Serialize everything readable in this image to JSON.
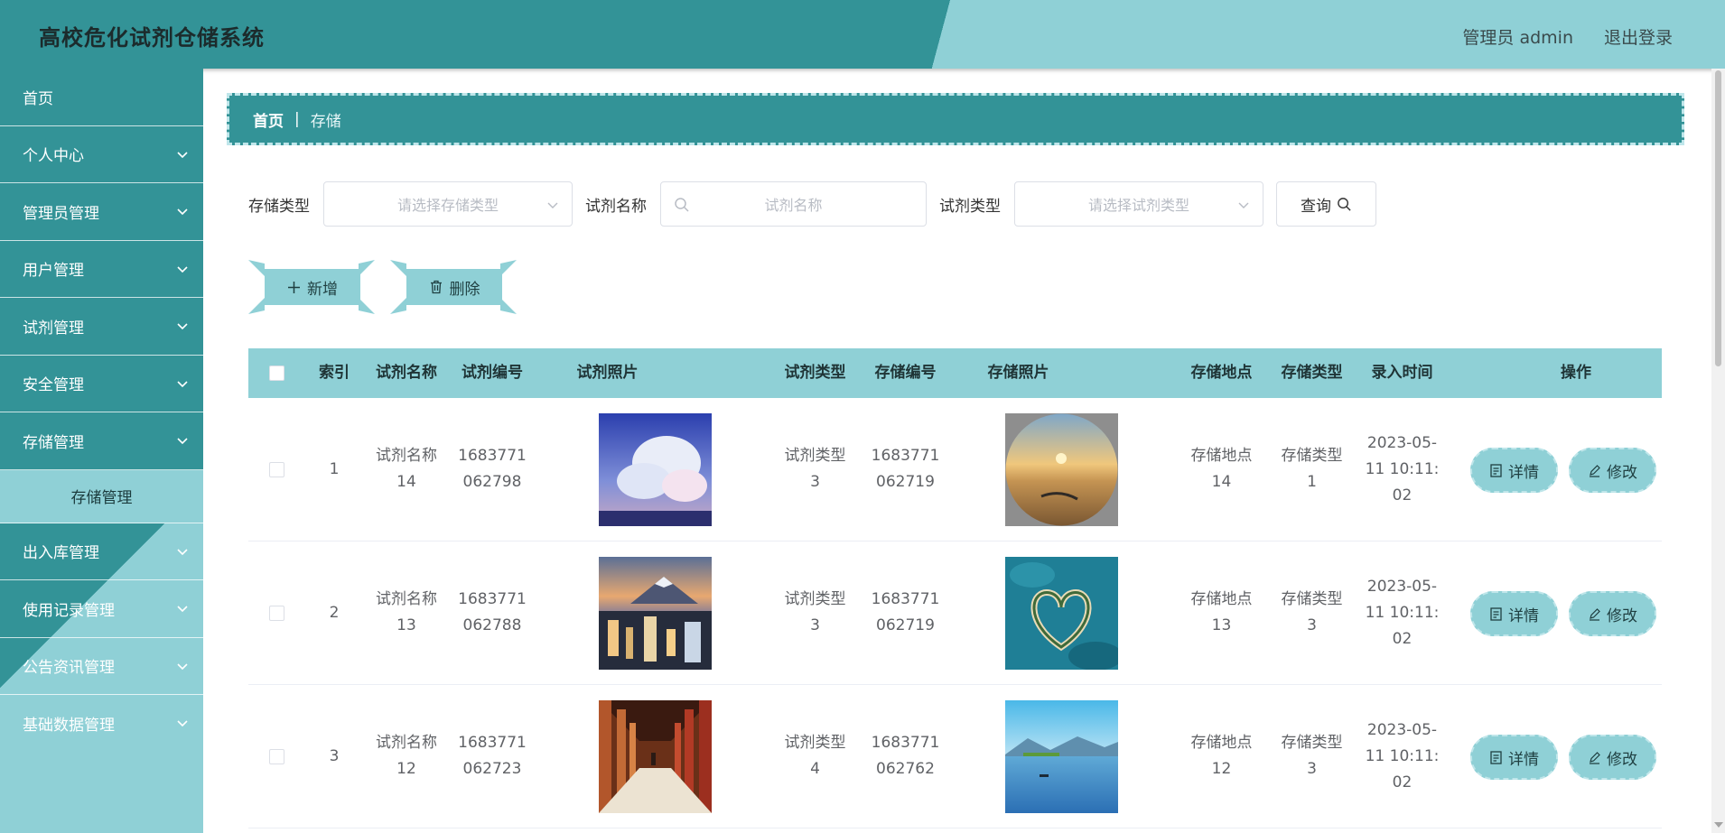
{
  "app": {
    "title": "高校危化试剂仓储系统",
    "user": "管理员 admin",
    "logout": "退出登录"
  },
  "sidebar": {
    "items": [
      {
        "label": "首页",
        "expandable": false
      },
      {
        "label": "个人中心",
        "expandable": true
      },
      {
        "label": "管理员管理",
        "expandable": true
      },
      {
        "label": "用户管理",
        "expandable": true
      },
      {
        "label": "试剂管理",
        "expandable": true
      },
      {
        "label": "安全管理",
        "expandable": true
      },
      {
        "label": "存储管理",
        "expandable": true,
        "open": true
      },
      {
        "label": "出入库管理",
        "expandable": true
      },
      {
        "label": "使用记录管理",
        "expandable": true
      },
      {
        "label": "公告资讯管理",
        "expandable": true
      },
      {
        "label": "基础数据管理",
        "expandable": true
      }
    ],
    "submenu": {
      "label": "存储管理"
    }
  },
  "breadcrumb": {
    "home": "首页",
    "separator": "|",
    "current": "存储"
  },
  "search": {
    "storage_type_label": "存储类型",
    "storage_type_placeholder": "请选择存储类型",
    "reagent_name_label": "试剂名称",
    "reagent_name_placeholder": "试剂名称",
    "reagent_type_label": "试剂类型",
    "reagent_type_placeholder": "请选择试剂类型",
    "query_label": "查询"
  },
  "actions": {
    "add_label": "新增",
    "delete_label": "删除"
  },
  "table": {
    "headers": [
      "索引",
      "试剂名称",
      "试剂编号",
      "试剂照片",
      "试剂类型",
      "存储编号",
      "存储照片",
      "存储地点",
      "存储类型",
      "录入时间",
      "操作"
    ],
    "detail_label": "详情",
    "edit_label": "修改",
    "rows": [
      {
        "index": "1",
        "name": [
          "试剂名称",
          "14"
        ],
        "code": [
          "1683771",
          "062798"
        ],
        "photo": "sky-clouds",
        "type": [
          "试剂类型",
          "3"
        ],
        "storage_code": [
          "1683771",
          "062719"
        ],
        "storage_photo": "desert-sunset",
        "location": [
          "存储地点",
          "14"
        ],
        "storage_type": [
          "存储类型",
          "1"
        ],
        "time": [
          "2023-05-",
          "11 10:11:",
          "02"
        ]
      },
      {
        "index": "2",
        "name": [
          "试剂名称",
          "13"
        ],
        "code": [
          "1683771",
          "062788"
        ],
        "photo": "city-mountain",
        "type": [
          "试剂类型",
          "3"
        ],
        "storage_code": [
          "1683771",
          "062719"
        ],
        "storage_photo": "heart-island",
        "location": [
          "存储地点",
          "13"
        ],
        "storage_type": [
          "存储类型",
          "3"
        ],
        "time": [
          "2023-05-",
          "11 10:11:",
          "02"
        ]
      },
      {
        "index": "3",
        "name": [
          "试剂名称",
          "12"
        ],
        "code": [
          "1683771",
          "062723"
        ],
        "photo": "corridor",
        "type": [
          "试剂类型",
          "4"
        ],
        "storage_code": [
          "1683771",
          "062762"
        ],
        "storage_photo": "lake",
        "location": [
          "存储地点",
          "12"
        ],
        "storage_type": [
          "存储类型",
          "3"
        ],
        "time": [
          "2023-05-",
          "11 10:11:",
          "02"
        ]
      }
    ]
  },
  "colors": {
    "primary": "#339397",
    "accent": "#8fd0d6",
    "border_dash": "#bfe6ea"
  }
}
